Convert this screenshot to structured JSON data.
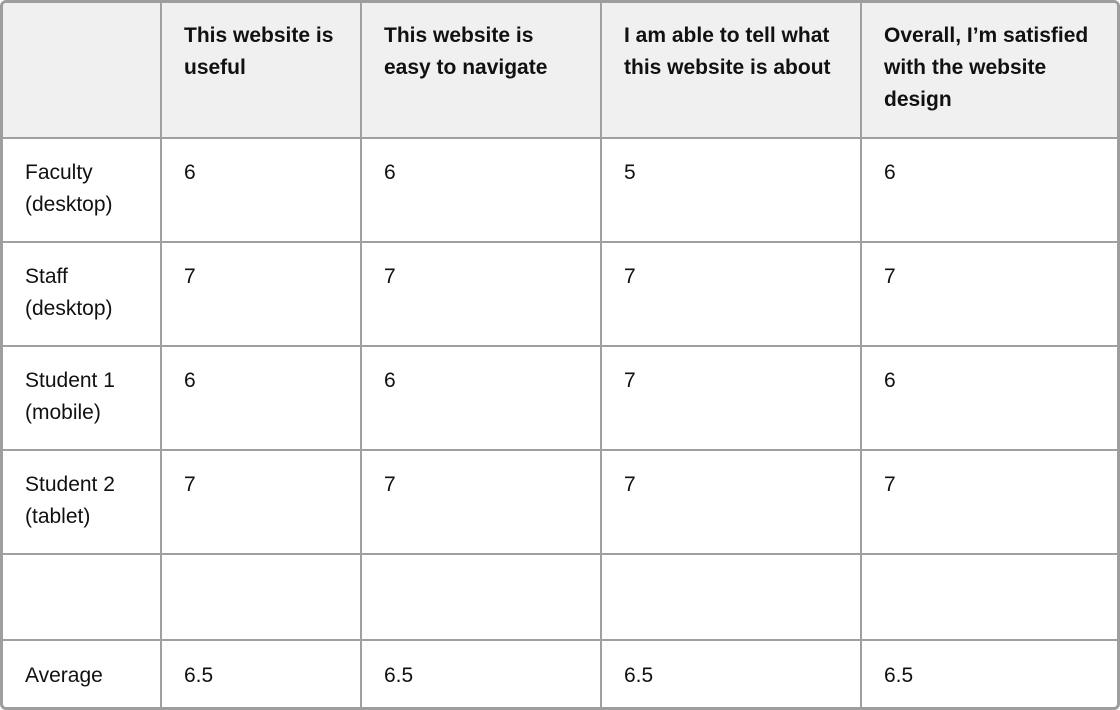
{
  "table": {
    "headers": [
      "",
      "This website is useful",
      "This website is easy to navigate",
      "I am able to tell what this website is about",
      "Overall, I’m satisfied with the website design"
    ],
    "rows": [
      {
        "label": "Faculty (desktop)",
        "values": [
          "6",
          "6",
          "5",
          "6"
        ]
      },
      {
        "label": "Staff (desktop)",
        "values": [
          "7",
          "7",
          "7",
          "7"
        ]
      },
      {
        "label": "Student 1 (mobile)",
        "values": [
          "6",
          "6",
          "7",
          "6"
        ]
      },
      {
        "label": "Student 2 (tablet)",
        "values": [
          "7",
          "7",
          "7",
          "7"
        ]
      },
      {
        "label": "",
        "values": [
          "",
          "",
          "",
          ""
        ]
      },
      {
        "label": "Average",
        "values": [
          "6.5",
          "6.5",
          "6.5",
          "6.5"
        ]
      }
    ]
  },
  "colors": {
    "header_bg": "#f0f0f0",
    "border": "#9e9e9e",
    "text": "#111111"
  }
}
